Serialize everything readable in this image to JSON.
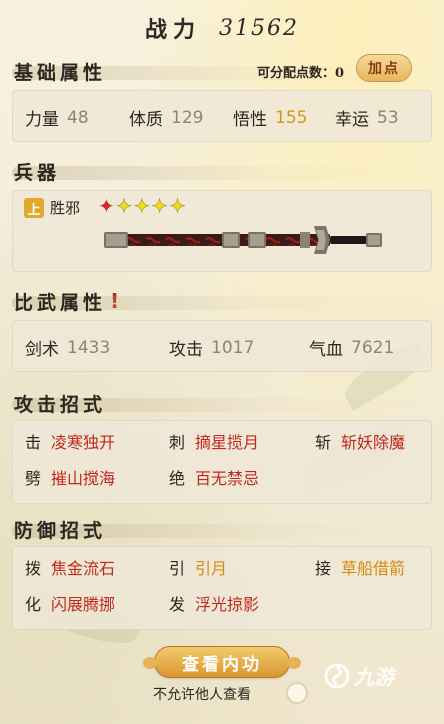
{
  "header": {
    "label": "战力",
    "value": "31562"
  },
  "basic": {
    "title": "基础属性",
    "alloc_label": "可分配点数：0",
    "add_button": "加点",
    "stats": [
      {
        "label": "力量",
        "value": "48"
      },
      {
        "label": "体质",
        "value": "129"
      },
      {
        "label": "悟性",
        "value": "155"
      },
      {
        "label": "幸运",
        "value": "53"
      }
    ]
  },
  "weapon": {
    "title": "兵器",
    "grade": "上",
    "name": "胜邪",
    "stars_red": 1,
    "stars_yellow": 4,
    "star_colors": {
      "red": "#cf2a2a",
      "yellow": "#f0d91f"
    }
  },
  "combat": {
    "title": "比武属性",
    "alert": "!",
    "stats": [
      {
        "label": "剑术",
        "value": "1433"
      },
      {
        "label": "攻击",
        "value": "1017"
      },
      {
        "label": "气血",
        "value": "7621"
      }
    ]
  },
  "attack": {
    "title": "攻击招式",
    "moves": [
      {
        "type": "击",
        "name": "凌寒独开"
      },
      {
        "type": "刺",
        "name": "摘星揽月"
      },
      {
        "type": "斩",
        "name": "斩妖除魔"
      },
      {
        "type": "劈",
        "name": "摧山搅海"
      },
      {
        "type": "绝",
        "name": "百无禁忌"
      }
    ]
  },
  "defense": {
    "title": "防御招式",
    "moves": [
      {
        "type": "拨",
        "name": "焦金流石"
      },
      {
        "type": "引",
        "name": "引月"
      },
      {
        "type": "接",
        "name": "草船借箭"
      },
      {
        "type": "化",
        "name": "闪展腾挪"
      },
      {
        "type": "发",
        "name": "浮光掠影"
      }
    ]
  },
  "footer": {
    "view_button": "查看内功",
    "permit_label": "不允许他人查看",
    "watermark": "九游"
  },
  "colors": {
    "accent_gold": "#d9941a",
    "move_red": "#c0281d",
    "move_gold": "#d68a12"
  }
}
